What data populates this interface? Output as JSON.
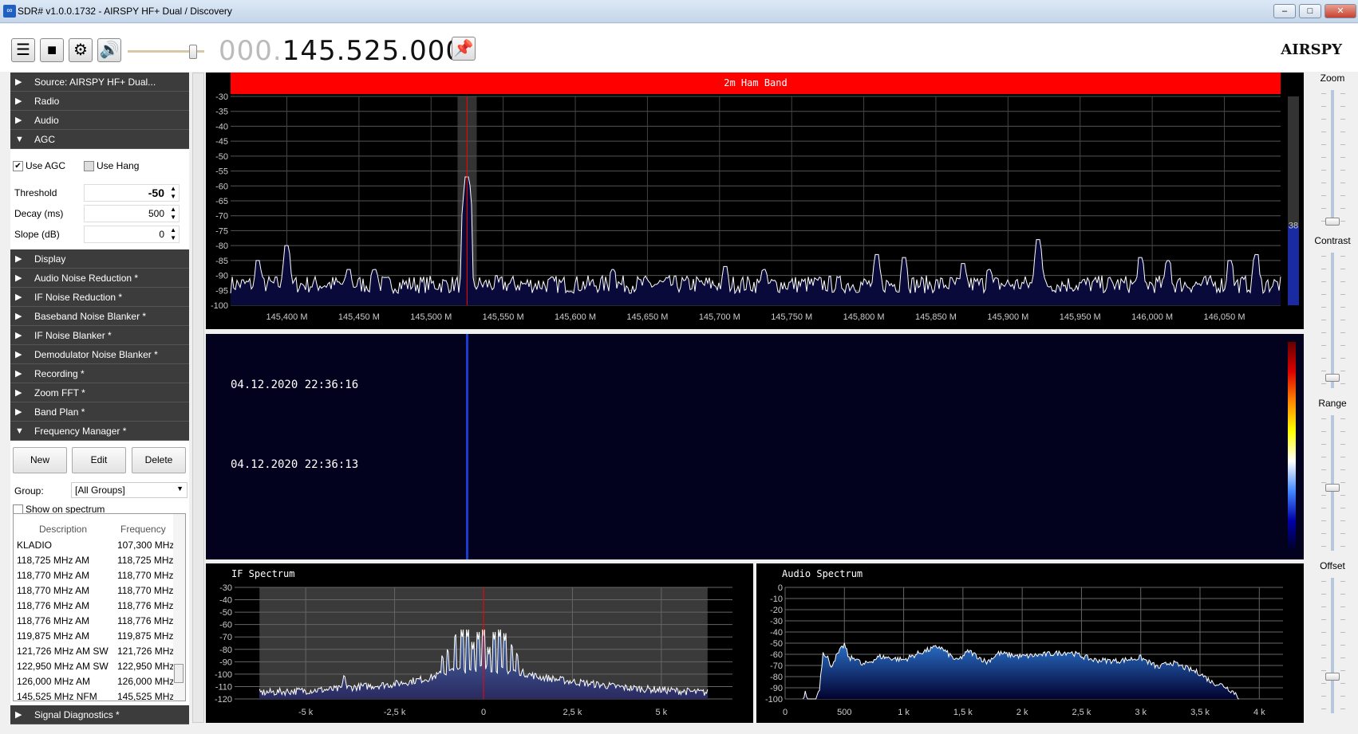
{
  "window": {
    "title": "SDR# v1.0.0.1732 - AIRSPY HF+ Dual / Discovery",
    "minimize": "–",
    "maximize": "□",
    "close": "✕"
  },
  "toolbar": {
    "menu_icon": "hamburger-icon",
    "stop_icon": "stop-icon",
    "settings_icon": "gear-icon",
    "audio_icon": "speaker-icon",
    "volume": 0.9,
    "freq_prefix": "000.",
    "freq_main": "145.525.000",
    "pin_icon": "pin-icon",
    "logo": "AIRSPY"
  },
  "sidebar": {
    "headers_top": [
      {
        "arrow": "▶",
        "label": "Source: AIRSPY HF+ Dual..."
      },
      {
        "arrow": "▶",
        "label": "Radio"
      },
      {
        "arrow": "▶",
        "label": "Audio"
      },
      {
        "arrow": "▼",
        "label": "AGC"
      }
    ],
    "agc": {
      "use_agc": "Use AGC",
      "use_agc_checked": true,
      "use_hang": "Use Hang",
      "use_hang_checked": false,
      "threshold_label": "Threshold",
      "threshold": "-50",
      "decay_label": "Decay (ms)",
      "decay": "500",
      "slope_label": "Slope (dB)",
      "slope": "0"
    },
    "headers_mid": [
      {
        "arrow": "▶",
        "label": "Display"
      },
      {
        "arrow": "▶",
        "label": "Audio Noise Reduction *"
      },
      {
        "arrow": "▶",
        "label": "IF Noise Reduction *"
      },
      {
        "arrow": "▶",
        "label": "Baseband Noise Blanker *"
      },
      {
        "arrow": "▶",
        "label": "IF Noise Blanker *"
      },
      {
        "arrow": "▶",
        "label": "Demodulator Noise Blanker *"
      },
      {
        "arrow": "▶",
        "label": "Recording *"
      },
      {
        "arrow": "▶",
        "label": "Zoom FFT *"
      },
      {
        "arrow": "▶",
        "label": "Band Plan *"
      },
      {
        "arrow": "▼",
        "label": "Frequency Manager *"
      }
    ],
    "fm": {
      "new": "New",
      "edit": "Edit",
      "delete": "Delete",
      "group_label": "Group:",
      "group_value": "[All Groups]",
      "show_on_spectrum": "Show on spectrum",
      "col_description": "Description",
      "col_frequency": "Frequency",
      "rows": [
        [
          "KLADIO",
          "107,300 MHz"
        ],
        [
          "118,725 MHz AM",
          "118,725 MHz"
        ],
        [
          "118,770 MHz AM",
          "118,770 MHz"
        ],
        [
          "118,770 MHz AM",
          "118,770 MHz"
        ],
        [
          "118,776 MHz AM",
          "118,776 MHz"
        ],
        [
          "118,776 MHz AM",
          "118,776 MHz"
        ],
        [
          "119,875 MHz AM",
          "119,875 MHz"
        ],
        [
          "121,726 MHz AM  SW",
          "121,726 MHz"
        ],
        [
          "122,950 MHz AM  SW",
          "122,950 MHz"
        ],
        [
          "126,000 MHz AM",
          "126,000 MHz"
        ],
        [
          "145,525 MHz NFM",
          "145,525 MHz"
        ]
      ]
    },
    "headers_bottom": [
      {
        "arrow": "▶",
        "label": "Signal Diagnostics *"
      }
    ]
  },
  "spectrum": {
    "band_label": "2m Ham Band",
    "level_value": "38",
    "level": 0.38
  },
  "waterfall": {
    "timestamps": [
      "04.12.2020 22:36:16",
      "04.12.2020 22:36:13"
    ]
  },
  "right_sliders": [
    {
      "label": "Zoom",
      "value": 0.0
    },
    {
      "label": "Contrast",
      "value": 0.05
    },
    {
      "label": "Range",
      "value": 0.45
    },
    {
      "label": "Offset",
      "value": 0.25
    }
  ],
  "chart_data": [
    {
      "type": "line",
      "xlim": [
        145361,
        146089
      ],
      "ylim": [
        -100,
        -30
      ],
      "xticks": [
        145400,
        145450,
        145500,
        145550,
        145600,
        145650,
        145700,
        145750,
        145800,
        145850,
        145900,
        145950,
        146000,
        146050
      ],
      "xtick_labels": [
        "145,400 M",
        "145,450 M",
        "145,500 M",
        "145,550 M",
        "145,600 M",
        "145,650 M",
        "145,700 M",
        "145,750 M",
        "145,800 M",
        "145,850 M",
        "145,900 M",
        "145,950 M",
        "146,000 M",
        "146,050 M"
      ],
      "yticks": [
        -30,
        -35,
        -40,
        -45,
        -50,
        -55,
        -60,
        -65,
        -70,
        -75,
        -80,
        -85,
        -90,
        -95,
        -100
      ],
      "noise_floor": -93,
      "tuned_frequency": 145525,
      "peaks": [
        [
          145380,
          -85
        ],
        [
          145400,
          -80
        ],
        [
          145443,
          -88
        ],
        [
          145461,
          -88
        ],
        [
          145525,
          -57
        ],
        [
          145626,
          -88
        ],
        [
          145704,
          -87
        ],
        [
          145731,
          -88
        ],
        [
          145809,
          -83
        ],
        [
          145828,
          -84
        ],
        [
          145869,
          -86
        ],
        [
          145887,
          -88
        ],
        [
          145921,
          -78
        ],
        [
          145992,
          -84
        ],
        [
          146011,
          -85
        ],
        [
          146054,
          -85
        ],
        [
          146072,
          -83
        ]
      ]
    },
    {
      "type": "area",
      "title": "IF Spectrum",
      "xlim": [
        -7000,
        7000
      ],
      "ylim": [
        -120,
        -30
      ],
      "data_range": [
        -6300,
        6300
      ],
      "xticks": [
        -5000,
        -2500,
        0,
        2500,
        5000
      ],
      "xtick_labels": [
        "-5 k",
        "-2,5 k",
        "0",
        "2,5 k",
        "5 k"
      ],
      "yticks": [
        -30,
        -40,
        -50,
        -60,
        -70,
        -80,
        -90,
        -100,
        -110,
        -120
      ],
      "envelope": [
        [
          -6300,
          -115
        ],
        [
          -4000,
          -112
        ],
        [
          -3900,
          -100
        ],
        [
          -3850,
          -111
        ],
        [
          -2500,
          -108
        ],
        [
          -1500,
          -103
        ],
        [
          -1000,
          -98
        ],
        [
          0,
          -95
        ],
        [
          1000,
          -98
        ],
        [
          1500,
          -102
        ],
        [
          2500,
          -106
        ],
        [
          4000,
          -111
        ],
        [
          6300,
          -115
        ]
      ],
      "tones": [
        [
          -1150,
          -89
        ],
        [
          -1000,
          -84
        ],
        [
          -800,
          -72
        ],
        [
          -600,
          -70
        ],
        [
          -450,
          -70
        ],
        [
          -300,
          -80
        ],
        [
          -150,
          -72
        ],
        [
          0,
          -70
        ],
        [
          150,
          -84
        ],
        [
          300,
          -72
        ],
        [
          450,
          -70
        ],
        [
          600,
          -73
        ],
        [
          800,
          -80
        ],
        [
          950,
          -87
        ]
      ]
    },
    {
      "type": "area",
      "title": "Audio Spectrum",
      "xlim": [
        0,
        4200
      ],
      "ylim": [
        -100,
        0
      ],
      "xticks": [
        0,
        500,
        1000,
        1500,
        2000,
        2500,
        3000,
        3500,
        4000
      ],
      "xtick_labels": [
        "0",
        "500",
        "1 k",
        "1,5 k",
        "2 k",
        "2,5 k",
        "3 k",
        "3,5 k",
        "4 k"
      ],
      "yticks": [
        0,
        -10,
        -20,
        -30,
        -40,
        -50,
        -60,
        -70,
        -80,
        -90,
        -100
      ],
      "values": [
        [
          150,
          -100
        ],
        [
          170,
          -94
        ],
        [
          190,
          -100
        ],
        [
          260,
          -100
        ],
        [
          290,
          -90
        ],
        [
          320,
          -58
        ],
        [
          360,
          -62
        ],
        [
          380,
          -72
        ],
        [
          420,
          -64
        ],
        [
          500,
          -51
        ],
        [
          540,
          -64
        ],
        [
          600,
          -63
        ],
        [
          650,
          -70
        ],
        [
          800,
          -62
        ],
        [
          1000,
          -65
        ],
        [
          1150,
          -58
        ],
        [
          1300,
          -53
        ],
        [
          1450,
          -66
        ],
        [
          1550,
          -57
        ],
        [
          1700,
          -67
        ],
        [
          1800,
          -59
        ],
        [
          2000,
          -62
        ],
        [
          2200,
          -60
        ],
        [
          2400,
          -58
        ],
        [
          2600,
          -65
        ],
        [
          2800,
          -66
        ],
        [
          3000,
          -63
        ],
        [
          3150,
          -72
        ],
        [
          3250,
          -67
        ],
        [
          3400,
          -73
        ],
        [
          3500,
          -77
        ],
        [
          3600,
          -85
        ],
        [
          3700,
          -88
        ],
        [
          3800,
          -95
        ],
        [
          3830,
          -100
        ]
      ]
    }
  ]
}
